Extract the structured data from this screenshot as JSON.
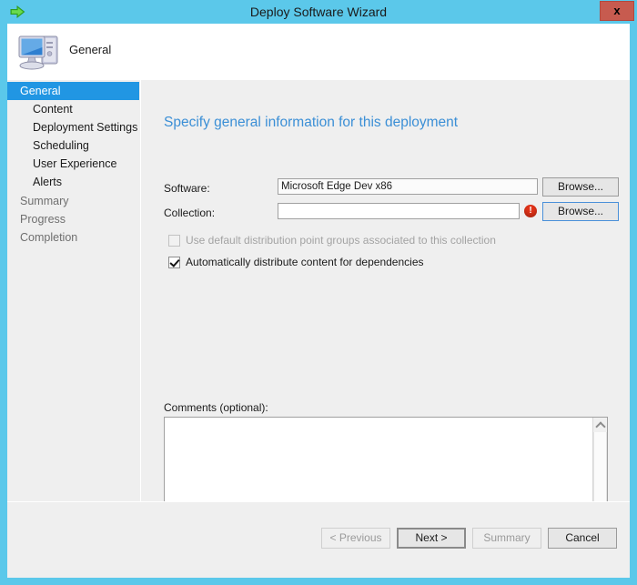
{
  "window": {
    "title": "Deploy Software Wizard",
    "system_icon": "green-right-arrow-icon",
    "close_label": "x"
  },
  "header": {
    "icon": "computer-icon",
    "title": "General"
  },
  "sidebar": {
    "items": [
      {
        "label": "General",
        "level": 0,
        "state": "active"
      },
      {
        "label": "Content",
        "level": 1,
        "state": "enabled"
      },
      {
        "label": "Deployment Settings",
        "level": 1,
        "state": "enabled"
      },
      {
        "label": "Scheduling",
        "level": 1,
        "state": "enabled"
      },
      {
        "label": "User Experience",
        "level": 1,
        "state": "enabled"
      },
      {
        "label": "Alerts",
        "level": 1,
        "state": "enabled"
      },
      {
        "label": "Summary",
        "level": 0,
        "state": "disabled"
      },
      {
        "label": "Progress",
        "level": 0,
        "state": "disabled"
      },
      {
        "label": "Completion",
        "level": 0,
        "state": "disabled"
      }
    ]
  },
  "main": {
    "heading": "Specify general information for this deployment",
    "software": {
      "label": "Software:",
      "value": "Microsoft Edge Dev x86",
      "browse_label": "Browse..."
    },
    "collection": {
      "label": "Collection:",
      "value": "",
      "placeholder": "",
      "browse_label": "Browse...",
      "error_icon": "error-exclamation-icon",
      "has_error": true
    },
    "checkboxes": [
      {
        "label": "Use default distribution point groups associated to this collection",
        "checked": false,
        "enabled": false
      },
      {
        "label": "Automatically distribute content for dependencies",
        "checked": true,
        "enabled": true
      }
    ],
    "comments": {
      "label": "Comments (optional):",
      "value": "",
      "scroll_up_icon": "chevron-up-icon",
      "scroll_down_icon": "chevron-down-icon"
    }
  },
  "footer": {
    "buttons": [
      {
        "label": "< Previous",
        "state": "disabled"
      },
      {
        "label": "Next >",
        "state": "default"
      },
      {
        "label": "Summary",
        "state": "disabled"
      },
      {
        "label": "Cancel",
        "state": "enabled"
      }
    ]
  },
  "colors": {
    "window_chrome": "#5bc8ea",
    "dialog_bg": "#efefef",
    "accent_blue": "#2196e3",
    "heading_blue": "#3b8fd6",
    "close_red": "#c75b4f",
    "error_red": "#e03218"
  }
}
